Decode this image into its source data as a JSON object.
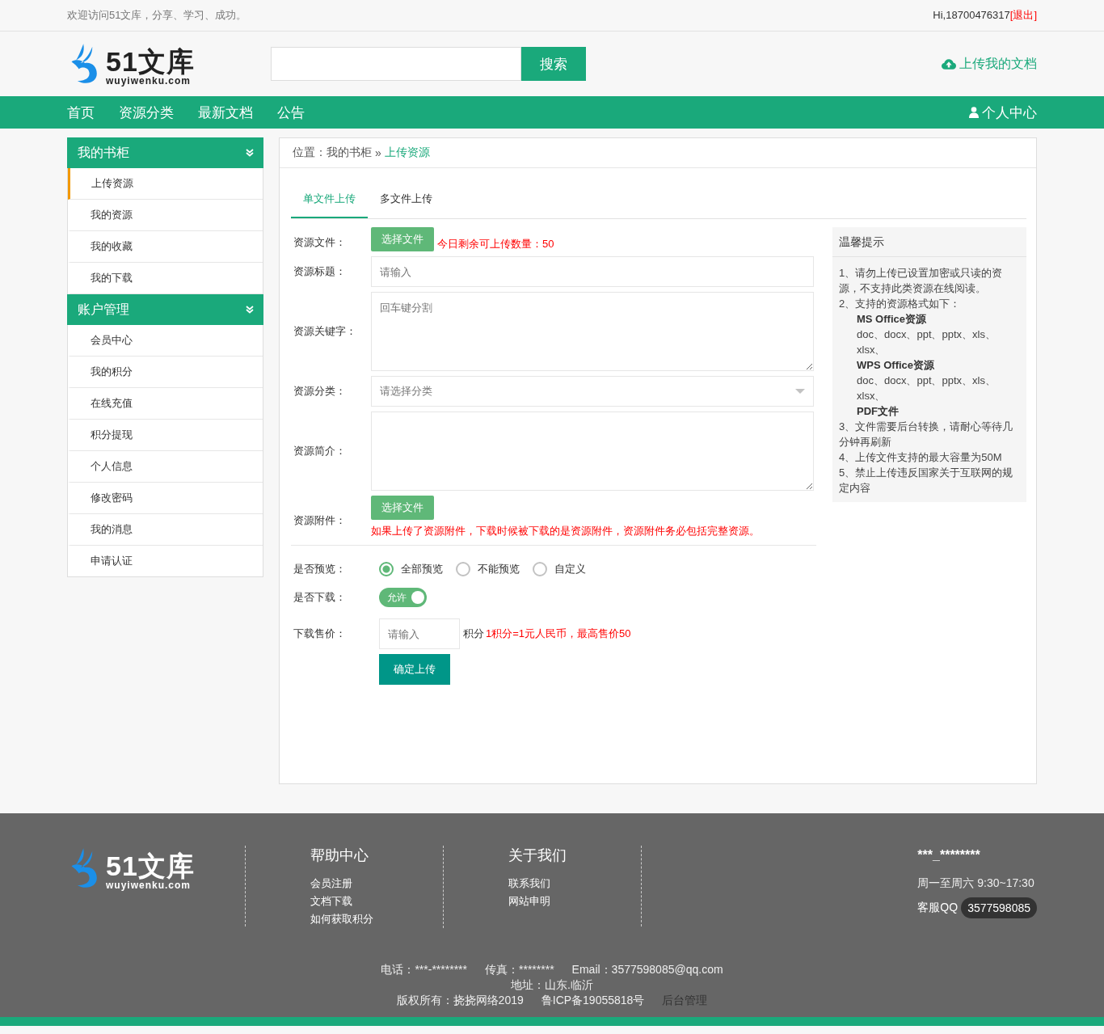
{
  "top_bar": {
    "welcome": "欢迎访问51文库，分享、学习、成功。",
    "greeting": "Hi,18700476317",
    "logout": "[退出]"
  },
  "header": {
    "logo": {
      "name": "51文库",
      "domain": "wuyiwenku.com"
    },
    "search": {
      "button": "搜索"
    },
    "upload_link": "上传我的文档"
  },
  "nav": {
    "items": [
      "首页",
      "资源分类",
      "最新文档",
      "公告"
    ],
    "user_center": "个人中心"
  },
  "sidebar": {
    "groups": [
      {
        "title": "我的书柜",
        "items": [
          {
            "label": "上传资源",
            "selected": true
          },
          {
            "label": "我的资源",
            "selected": false
          },
          {
            "label": "我的收藏",
            "selected": false
          },
          {
            "label": "我的下载",
            "selected": false
          }
        ]
      },
      {
        "title": "账户管理",
        "items": [
          {
            "label": "会员中心",
            "selected": false
          },
          {
            "label": "我的积分",
            "selected": false
          },
          {
            "label": "在线充值",
            "selected": false
          },
          {
            "label": "积分提现",
            "selected": false
          },
          {
            "label": "个人信息",
            "selected": false
          },
          {
            "label": "修改密码",
            "selected": false
          },
          {
            "label": "我的消息",
            "selected": false
          },
          {
            "label": "申请认证",
            "selected": false
          }
        ]
      }
    ]
  },
  "breadcrumb": {
    "prefix": "位置：",
    "parent": "我的书柜",
    "separator": "»",
    "current": "上传资源"
  },
  "tabs": [
    {
      "label": "单文件上传",
      "selected": true
    },
    {
      "label": "多文件上传",
      "selected": false
    }
  ],
  "form": [
    {
      "kind": "file",
      "label": "资源文件：",
      "button": "选择文件",
      "note": "今日剩余可上传数量：50"
    },
    {
      "kind": "text",
      "label": "资源标题：",
      "placeholder": "请输入"
    },
    {
      "kind": "textarea",
      "label": "资源关键字：",
      "placeholder": "回车键分割"
    },
    {
      "kind": "select",
      "label": "资源分类：",
      "placeholder": "请选择分类"
    },
    {
      "kind": "textarea",
      "label": "资源简介："
    },
    {
      "kind": "attachment",
      "label": "资源附件：",
      "button": "选择文件",
      "note": "如果上传了资源附件，下载时候被下载的是资源附件，资源附件务必包括完整资源。"
    },
    {
      "kind": "divider"
    },
    {
      "kind": "radio",
      "label": "是否预览：",
      "options": [
        {
          "label": "全部预览",
          "selected": true
        },
        {
          "label": "不能预览",
          "selected": false
        },
        {
          "label": "自定义",
          "selected": false
        }
      ]
    },
    {
      "kind": "toggle",
      "label": "是否下载：",
      "on": true,
      "text": "允许"
    },
    {
      "kind": "price",
      "label": "下载售价：",
      "placeholder": "请输入",
      "unit": "积分",
      "note": "1积分=1元人民币，最高售价50"
    },
    {
      "kind": "submit",
      "button": "确定上传"
    }
  ],
  "tips": {
    "title": "温馨提示",
    "lines": [
      {
        "kind": "item",
        "text": "1、请勿上传已设置加密或只读的资源，不支持此类资源在线阅读。"
      },
      {
        "kind": "item",
        "text": "2、支持的资源格式如下："
      },
      {
        "kind": "heading",
        "text": "MS Office资源"
      },
      {
        "kind": "formats",
        "text": "doc、docx、ppt、pptx、xls、xlsx、"
      },
      {
        "kind": "heading",
        "text": "WPS Office资源"
      },
      {
        "kind": "formats",
        "text": "doc、docx、ppt、pptx、xls、xlsx、"
      },
      {
        "kind": "heading",
        "text": "PDF文件"
      },
      {
        "kind": "item",
        "text": "3、文件需要后台转换，请耐心等待几分钟再刷新"
      },
      {
        "kind": "item",
        "text": "4、上传文件支持的最大容量为50M"
      },
      {
        "kind": "item",
        "text": "5、禁止上传违反国家关于互联网的规定内容"
      }
    ]
  },
  "footer": {
    "logo": {
      "name": "51文库",
      "domain": "wuyiwenku.com"
    },
    "columns": [
      {
        "title": "帮助中心",
        "links": [
          "会员注册",
          "文档下载",
          "如何获取积分"
        ]
      },
      {
        "title": "关于我们",
        "links": [
          "联系我们",
          "网站申明"
        ]
      }
    ],
    "contact": {
      "phone": "***_********",
      "hours": "周一至周六 9:30~17:30",
      "qq_label": "客服QQ",
      "qq": "3577598085"
    },
    "info_lines": [
      [
        "电话：***-********",
        "传真：********",
        "Email：3577598085@qq.com"
      ],
      [
        "地址：山东.临沂"
      ],
      [
        "版权所有：挠挠网络2019",
        "鲁ICP备19055818号"
      ]
    ],
    "admin_link": "后台管理"
  }
}
